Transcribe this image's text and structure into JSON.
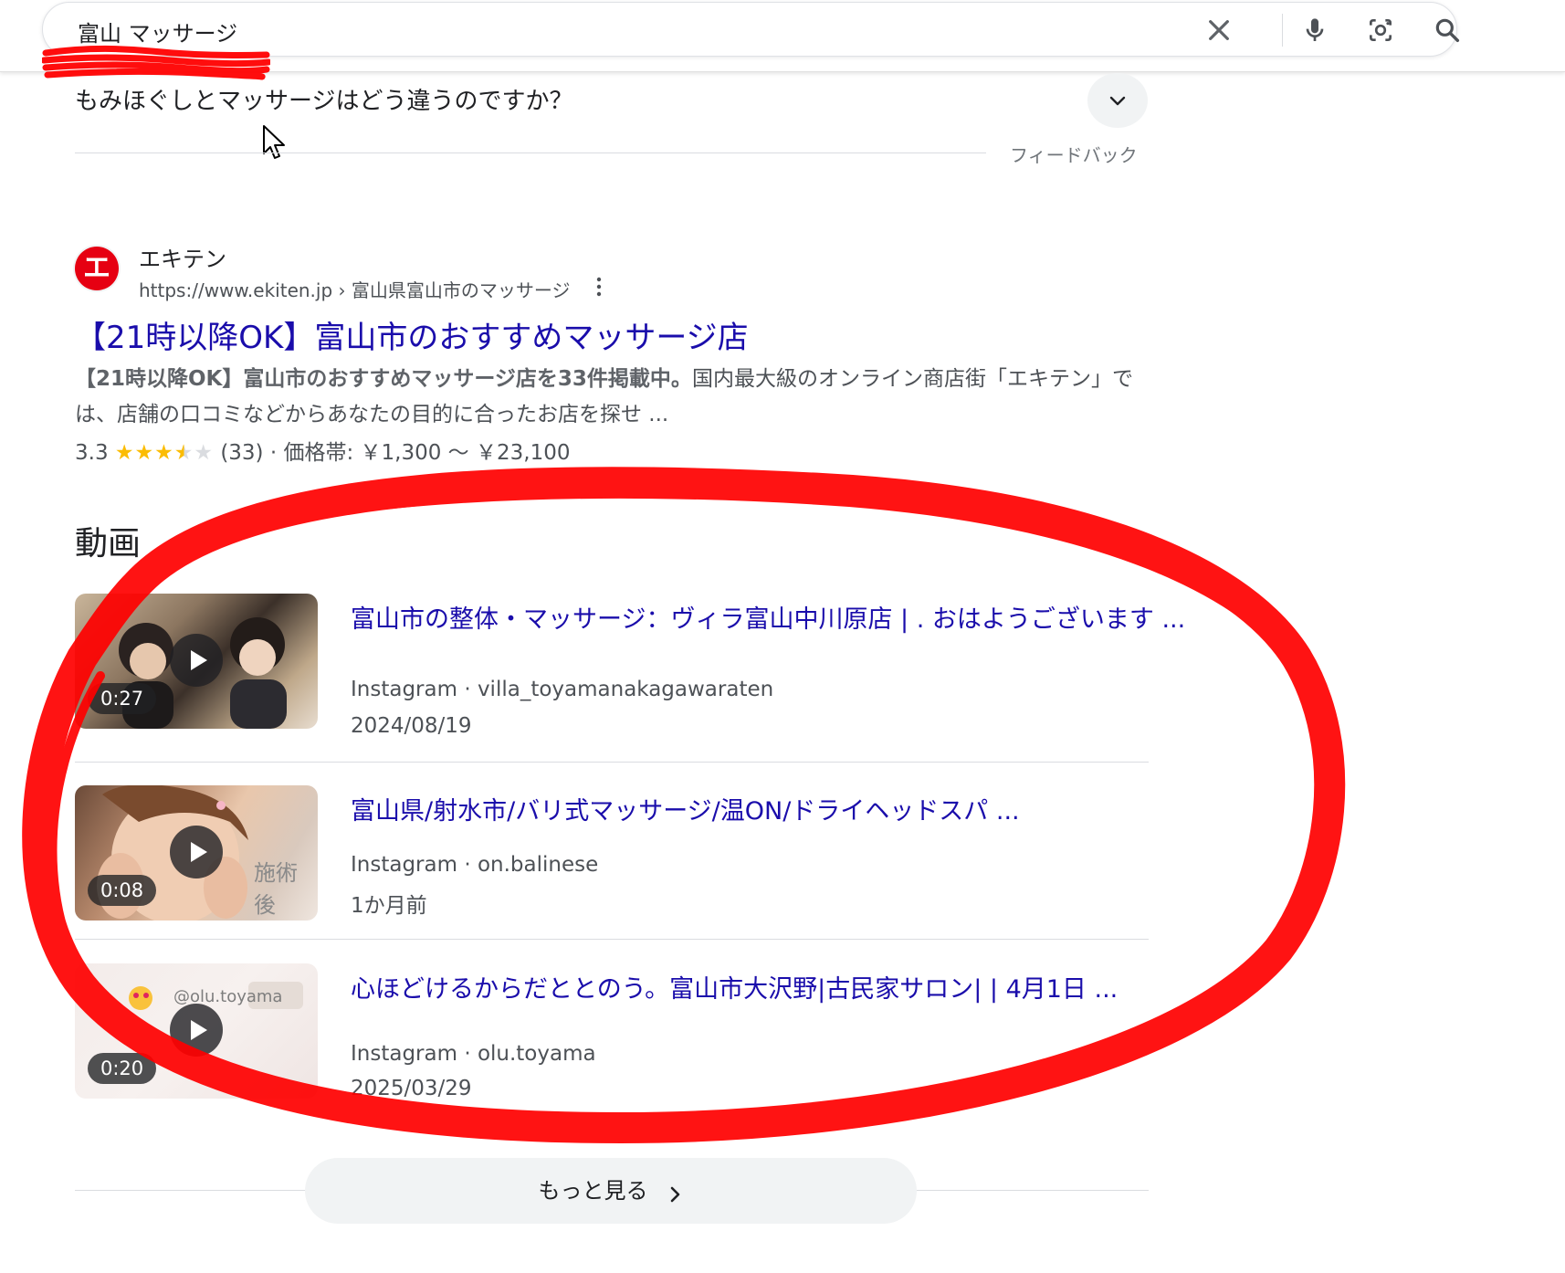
{
  "search": {
    "query": "富山 マッサージ",
    "clear_icon": "close-icon",
    "voice_icon": "microphone-icon",
    "lens_icon": "camera-lens-icon",
    "search_icon": "search-icon"
  },
  "paa": {
    "question": "もみほぐしとマッサージはどう違うのですか？",
    "feedback": "フィードバック"
  },
  "result": {
    "favicon_letter": "エ",
    "site_name": "エキテン",
    "url": "https://www.ekiten.jp › 富山県富山市のマッサージ",
    "title": "【21時以降OK】富山市のおすすめマッサージ店",
    "snippet_bold": "【21時以降OK】富山市のおすすめマッサージ店を33件掲載中。",
    "snippet_rest": "国内最大級のオンライン商店街「エキテン」では、店舗の口コミなどからあなたの目的に合ったお店を探せ ...",
    "rating": "3.3",
    "rating_value": 3.3,
    "reviews": "(33)",
    "price": "· 価格帯: ￥1,300 〜 ￥23,100",
    "brand_color": "#e60012"
  },
  "videos": {
    "heading": "動画",
    "items": [
      {
        "title": "富山市の整体・マッサージ：ヴィラ富山中川原店 | . おはようございます ...",
        "source": "Instagram · villa_toyamanakagawaraten",
        "date": "2024/08/19",
        "duration": "0:27"
      },
      {
        "title": "富山県/射水市/バリ式マッサージ/温ON/ドライヘッドスパ ...",
        "source": "Instagram · on.balinese",
        "date": "1か月前",
        "duration": "0:08",
        "overlay_text": "施術後"
      },
      {
        "title": "心ほどけるからだととのう。富山市大沢野|古民家サロン| | 4月1日 ...",
        "source": "Instagram · olu.toyama",
        "date": "2025/03/29",
        "duration": "0:20",
        "overlay_text": "@olu.toyama"
      }
    ],
    "more_label": "もっと見る"
  },
  "colors": {
    "link": "#1a0dab",
    "annotation": "#ff0000"
  }
}
